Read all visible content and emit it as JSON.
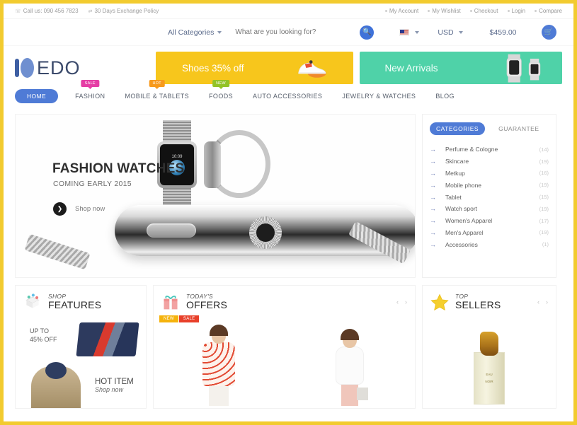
{
  "topbar": {
    "phone": "Call us: 090 456 7823",
    "phone_icon": "phone-icon",
    "policy": "30 Days Exchange Policy",
    "policy_icon": "exchange-icon",
    "links": [
      "My Account",
      "My Wishlist",
      "Checkout",
      "Login",
      "Compare"
    ]
  },
  "search": {
    "category_label": "All Categories",
    "placeholder": "What are you looking for?",
    "value": "",
    "search_icon": "search-icon",
    "flag_icon": "us-flag-icon",
    "currency": "USD",
    "cart_total": "$459.00",
    "cart_icon": "shopping-cart-icon"
  },
  "brand": {
    "logo_text": "EDO",
    "logo_icon": "edo-circle-logo-icon"
  },
  "banners": [
    {
      "title": "Shoes 35% off",
      "color": "#f7c61c",
      "image_icon": "sneaker-shoe-image"
    },
    {
      "title": "New Arrivals",
      "color": "#4fd2a8",
      "image_icon": "smart-watches-image"
    }
  ],
  "nav": [
    {
      "label": "HOME",
      "badge": "",
      "active": true
    },
    {
      "label": "FASHION",
      "badge": "SALE",
      "badge_type": "sale"
    },
    {
      "label": "MOBILE & TABLETS",
      "badge": "HOT",
      "badge_type": "hot"
    },
    {
      "label": "FOODS",
      "badge": "NEW",
      "badge_type": "new"
    },
    {
      "label": "AUTO ACCESSORIES",
      "badge": ""
    },
    {
      "label": "JEWELRY & WATCHES",
      "badge": ""
    },
    {
      "label": "BLOG",
      "badge": ""
    }
  ],
  "hero": {
    "title": "FASHION WATCHES",
    "subtitle": "COMING EARLY 2015",
    "cta": "Shop now",
    "cta_icon": "chevron-right-icon",
    "watch_time": "10:09",
    "image_icon": "fashion-watch-hero-image"
  },
  "sidebar": {
    "tabs": [
      {
        "label": "CATEGORIES",
        "active": true
      },
      {
        "label": "GUARANTEE",
        "active": false
      }
    ],
    "categories": [
      {
        "label": "Perfume & Cologne",
        "count": "(14)"
      },
      {
        "label": "Skincare",
        "count": "(19)"
      },
      {
        "label": "Metkup",
        "count": "(16)"
      },
      {
        "label": "Mobile phone",
        "count": "(19)"
      },
      {
        "label": "Tablet",
        "count": "(15)"
      },
      {
        "label": "Watch sport",
        "count": "(19)"
      },
      {
        "label": "Women's Apparel",
        "count": "(17)"
      },
      {
        "label": "Men's Apparel",
        "count": "(19)"
      },
      {
        "label": "Accessories",
        "count": "(1)"
      }
    ]
  },
  "panels": {
    "features": {
      "top": "SHOP",
      "bottom": "FEATURES",
      "icon": "shop-features-icon",
      "promo1": {
        "line1": "UP TO",
        "line2": "45% OFF",
        "image_icon": "folded-shirts-image"
      },
      "promo2": {
        "title": "HOT ITEM",
        "subtitle": "Shop now",
        "image_icon": "jacket-model-image"
      }
    },
    "offers": {
      "top": "TODAY'S",
      "bottom": "OFFERS",
      "icon": "gift-box-icon",
      "prev_icon": "chevron-left-icon",
      "next_icon": "chevron-right-icon",
      "items": [
        {
          "tags": [
            "NEW",
            "SALE"
          ],
          "image_icon": "polka-dot-outfit-model-image"
        },
        {
          "tags": [],
          "image_icon": "white-dress-model-image"
        }
      ]
    },
    "sellers": {
      "top": "TOP",
      "bottom": "SELLERS",
      "icon": "star-icon",
      "prev_icon": "chevron-left-icon",
      "next_icon": "chevron-right-icon",
      "item": {
        "image_icon": "perfume-bottle-image",
        "label_line1": "EAU",
        "label_line2": "NOIR"
      }
    }
  }
}
